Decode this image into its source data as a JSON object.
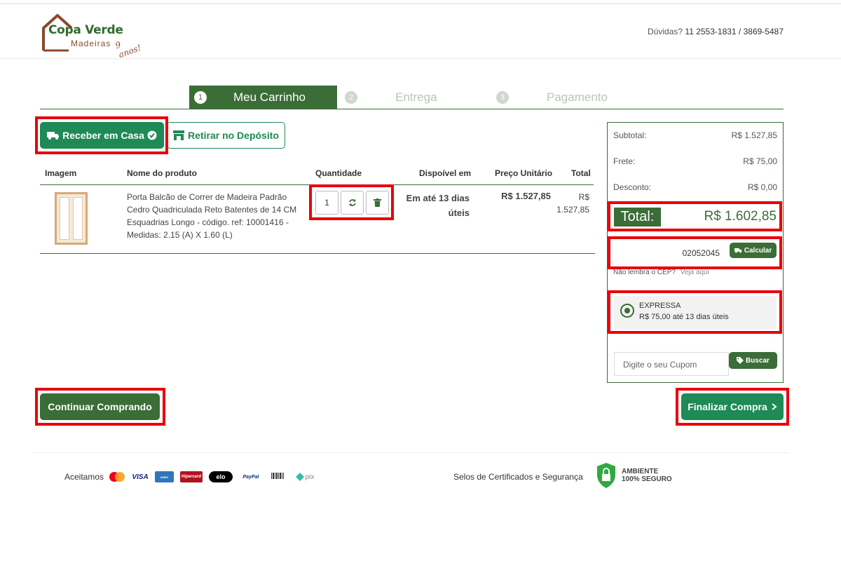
{
  "header": {
    "brand": "Copa Verde",
    "brand_sub": "Madeiras",
    "brand_tag": "9 anos!",
    "contact_label": "Dúvidas?",
    "contact_phones": "11 2553-1831 / 3869-5487"
  },
  "steps": [
    {
      "num": "1",
      "label": "Meu Carrinho"
    },
    {
      "num": "2",
      "label": "Entrega"
    },
    {
      "num": "3",
      "label": "Pagamento"
    }
  ],
  "delivery": {
    "home_label": "Receber em Casa",
    "pickup_label": "Retirar no Depósito"
  },
  "table": {
    "headers": [
      "Imagem",
      "Nome do produto",
      "Quantidade",
      "Dispoível em",
      "Preço Unitário",
      "Total"
    ],
    "rows": [
      {
        "name": "Porta Balcão de Correr de Madeira Padrão Cedro Quadriculada Reto Batentes de 14 CM Esquadrias Longo - código. ref: 10001416 - Medidas: 2.15 (A) X 1.60 (L)",
        "quantity": "1",
        "availability": "Em até 13 dias úteis",
        "unit_price": "R$ 1.527,85",
        "total": "R$ 1.527,85"
      }
    ]
  },
  "summary": {
    "subtotal_label": "Subtotal:",
    "subtotal_value": "R$ 1.527,85",
    "frete_label": "Frete:",
    "frete_value": "R$ 75,00",
    "desconto_label": "Desconto:",
    "desconto_value": "R$ 0,00",
    "total_label": "Total:",
    "total_value": "R$ 1.602,85",
    "cep_value": "02052045",
    "calc_label": "Calcular",
    "cep_help": "Não lembra o CEP?",
    "cep_link": "Veja aqui",
    "shipping_name": "EXPRESSA",
    "shipping_price": "R$ 75,00 até 13 dias úteis",
    "coupon_placeholder": "Digite o seu Cupom",
    "coupon_button": "Buscar"
  },
  "actions": {
    "continue_label": "Continuar Comprando",
    "finish_label": "Finalizar Compra"
  },
  "footer": {
    "accept_label": "Aceitamos",
    "payments": [
      "MasterCard",
      "VISA",
      "AMERICAN EXPRESS",
      "Hipercard",
      "elo",
      "PayPal",
      "Boleto",
      "pix"
    ],
    "seals_label": "Selos de Certificados e Segurança",
    "secure_line1": "AMBIENTE",
    "secure_line2": "100% SEGURO"
  },
  "colors": {
    "primary_green": "#3b6d37",
    "accent_green": "#1e8a55",
    "highlight_red": "#e8000b",
    "brand_brown": "#8b4a2b"
  }
}
